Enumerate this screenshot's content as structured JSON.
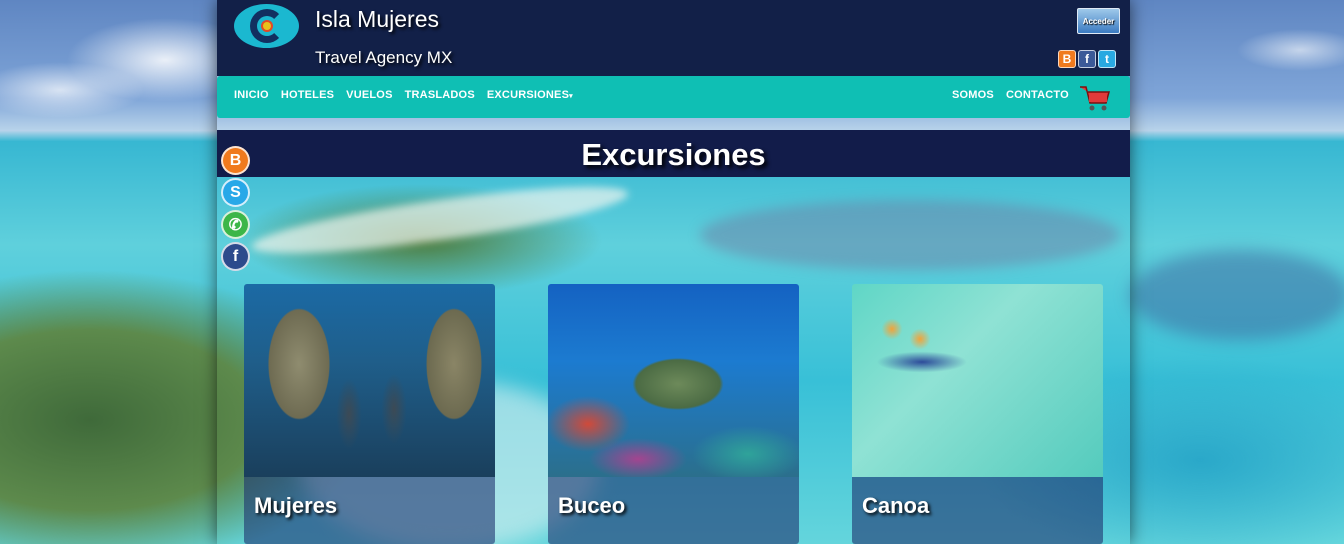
{
  "header": {
    "title": "Isla Mujeres",
    "subtitle": "Travel Agency MX",
    "login_label": "Acceder",
    "social_icons": [
      "blogger-icon",
      "facebook-icon",
      "twitter-icon"
    ]
  },
  "nav": {
    "left_items": [
      {
        "label": "INICIO"
      },
      {
        "label": "HOTELES"
      },
      {
        "label": "VUELOS"
      },
      {
        "label": "TRASLADOS"
      },
      {
        "label": "EXCURSIONES"
      }
    ],
    "dropdown_caret": "▾",
    "right_items": [
      {
        "label": "SOMOS"
      },
      {
        "label": "CONTACTO"
      }
    ],
    "cart_icon": "shopping-cart-icon"
  },
  "page": {
    "title": "Excursiones"
  },
  "floating_social": [
    "blogger-icon",
    "skype-icon",
    "whatsapp-icon",
    "facebook-icon"
  ],
  "cards": [
    {
      "label": "Mujeres"
    },
    {
      "label": "Buceo"
    },
    {
      "label": "Canoa"
    }
  ],
  "colors": {
    "header_bg": "#122048",
    "nav_bg": "#0fbfb4",
    "title_band_bg": "#121c4a"
  }
}
